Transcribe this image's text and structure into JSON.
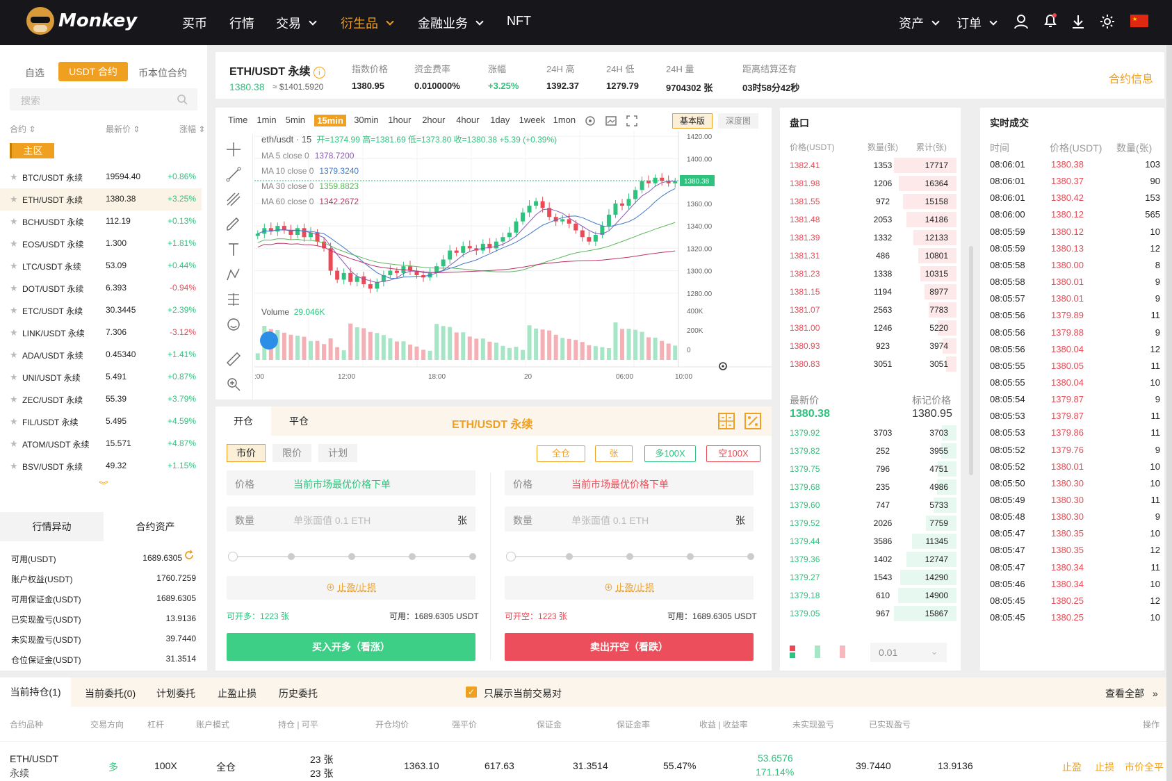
{
  "brand": {
    "name": "Monkey"
  },
  "nav": [
    {
      "label": "买币",
      "dropdown": false
    },
    {
      "label": "行情",
      "dropdown": false
    },
    {
      "label": "交易",
      "dropdown": true
    },
    {
      "label": "衍生品",
      "dropdown": true,
      "active": true
    },
    {
      "label": "金融业务",
      "dropdown": true
    },
    {
      "label": "NFT",
      "dropdown": false
    }
  ],
  "nav_right": [
    {
      "label": "资产"
    },
    {
      "label": "订单"
    }
  ],
  "colors": {
    "accent": "#f0a020",
    "up": "#2ec27e",
    "down": "#ea4a55",
    "header": "#17171b"
  },
  "market_tabs": [
    "自选",
    "USDT 合约",
    "币本位合约"
  ],
  "search_placeholder": "搜索",
  "market_cols": [
    "合约",
    "最新价",
    "涨幅"
  ],
  "zone": "主区",
  "markets": [
    {
      "name": "BTC/USDT 永续",
      "price": "19594.40",
      "change": "+0.86%",
      "dir": "up"
    },
    {
      "name": "ETH/USDT 永续",
      "price": "1380.38",
      "change": "+3.25%",
      "dir": "up"
    },
    {
      "name": "BCH/USDT 永续",
      "price": "112.19",
      "change": "+0.13%",
      "dir": "up"
    },
    {
      "name": "EOS/USDT 永续",
      "price": "1.300",
      "change": "+1.81%",
      "dir": "up"
    },
    {
      "name": "LTC/USDT 永续",
      "price": "53.09",
      "change": "+0.44%",
      "dir": "up"
    },
    {
      "name": "DOT/USDT 永续",
      "price": "6.393",
      "change": "-0.94%",
      "dir": "down"
    },
    {
      "name": "ETC/USDT 永续",
      "price": "30.3445",
      "change": "+2.39%",
      "dir": "up"
    },
    {
      "name": "LINK/USDT 永续",
      "price": "7.306",
      "change": "-3.12%",
      "dir": "down"
    },
    {
      "name": "ADA/USDT 永续",
      "price": "0.45340",
      "change": "+1.41%",
      "dir": "up"
    },
    {
      "name": "UNI/USDT 永续",
      "price": "5.491",
      "change": "+0.87%",
      "dir": "up"
    },
    {
      "name": "ZEC/USDT 永续",
      "price": "55.39",
      "change": "+3.79%",
      "dir": "up"
    },
    {
      "name": "FIL/USDT 永续",
      "price": "5.495",
      "change": "+4.59%",
      "dir": "up"
    },
    {
      "name": "ATOM/USDT 永续",
      "price": "15.571",
      "change": "+4.87%",
      "dir": "up"
    },
    {
      "name": "BSV/USDT 永续",
      "price": "49.32",
      "change": "+1.15%",
      "dir": "up"
    }
  ],
  "asset_tabs": [
    "行情异动",
    "合约资产"
  ],
  "assets": [
    {
      "label": "可用(USDT)",
      "value": "1689.6305"
    },
    {
      "label": "账户权益(USDT)",
      "value": "1760.7259"
    },
    {
      "label": "可用保证金(USDT)",
      "value": "1689.6305"
    },
    {
      "label": "已实现盈亏(USDT)",
      "value": "13.9136"
    },
    {
      "label": "未实现盈亏(USDT)",
      "value": "39.7440"
    },
    {
      "label": "仓位保证金(USDT)",
      "value": "31.3514"
    }
  ],
  "ticker": {
    "symbol": "ETH/USDT 永续",
    "last": "1380.38",
    "last_usd": "≈ $1401.5920",
    "stats": [
      {
        "label": "指数价格",
        "value": "1380.95"
      },
      {
        "label": "资金费率",
        "value": "0.010000%"
      },
      {
        "label": "涨幅",
        "value": "+3.25%"
      },
      {
        "label": "24H 高",
        "value": "1392.37"
      },
      {
        "label": "24H 低",
        "value": "1279.79"
      },
      {
        "label": "24H 量",
        "value": "9704302 张"
      },
      {
        "label": "距离结算还有",
        "value": "03时58分42秒"
      }
    ],
    "info_link": "合约信息"
  },
  "chart_toolbar": {
    "intervals": [
      "Time",
      "1min",
      "5min",
      "15min",
      "30min",
      "1hour",
      "2hour",
      "4hour",
      "1day",
      "1week",
      "1mon"
    ],
    "active": "15min",
    "modes": [
      "基本版",
      "深度图"
    ]
  },
  "chart_legend": {
    "head": "eth/usdt · 15",
    "ohlc": "开=1374.99 高=1381.69 低=1373.80 收=1380.38 +5.39 (+0.39%)",
    "ma": [
      {
        "label": "MA 5 close 0",
        "value": "1378.7200",
        "color": "#8c5ab8"
      },
      {
        "label": "MA 10 close 0",
        "value": "1379.3240",
        "color": "#3f78c8"
      },
      {
        "label": "MA 30 close 0",
        "value": "1359.8823",
        "color": "#5cb85c"
      },
      {
        "label": "MA 60 close 0",
        "value": "1342.2672",
        "color": "#c0306a"
      }
    ],
    "volume_label": "Volume",
    "volume_value": "29.046K",
    "price_tag": "1380.38"
  },
  "chart_data": {
    "type": "candlestick",
    "y_ticks": [
      "1420.00",
      "1400.00",
      "1380.00",
      "1360.00",
      "1340.00",
      "1320.00",
      "1300.00",
      "1280.00"
    ],
    "ylim": [
      1270,
      1425
    ],
    "vol_ticks": [
      "400K",
      "200K",
      "0"
    ],
    "x_ticks": [
      ":00",
      "12:00",
      "18:00",
      "20",
      "06:00",
      "10:00"
    ],
    "close": [
      1333,
      1338,
      1335,
      1340,
      1336,
      1332,
      1338,
      1330,
      1334,
      1326,
      1320,
      1300,
      1292,
      1298,
      1290,
      1295,
      1288,
      1284,
      1290,
      1296,
      1300,
      1298,
      1304,
      1300,
      1296,
      1294,
      1298,
      1304,
      1310,
      1318,
      1316,
      1322,
      1320,
      1318,
      1324,
      1320,
      1326,
      1330,
      1334,
      1344,
      1352,
      1358,
      1362,
      1356,
      1348,
      1344,
      1346,
      1342,
      1336,
      1330,
      1326,
      1332,
      1340,
      1350,
      1360,
      1358,
      1364,
      1372,
      1380,
      1378,
      1383,
      1380,
      1378,
      1380
    ]
  },
  "orderbook": {
    "title": "盘口",
    "cols": [
      "价格(USDT)",
      "数量(张)",
      "累计(张)"
    ],
    "asks": [
      [
        "1382.41",
        "1353",
        "17717"
      ],
      [
        "1381.98",
        "1206",
        "16364"
      ],
      [
        "1381.55",
        "972",
        "15158"
      ],
      [
        "1381.48",
        "2053",
        "14186"
      ],
      [
        "1381.39",
        "1332",
        "12133"
      ],
      [
        "1381.31",
        "486",
        "10801"
      ],
      [
        "1381.23",
        "1338",
        "10315"
      ],
      [
        "1381.15",
        "1194",
        "8977"
      ],
      [
        "1381.07",
        "2563",
        "7783"
      ],
      [
        "1381.00",
        "1246",
        "5220"
      ],
      [
        "1380.93",
        "923",
        "3974"
      ],
      [
        "1380.83",
        "3051",
        "3051"
      ]
    ],
    "last_label": "最新价",
    "mark_label": "标记价格",
    "last": "1380.38",
    "mark": "1380.95",
    "bids": [
      [
        "1379.92",
        "3703",
        "3703"
      ],
      [
        "1379.82",
        "252",
        "3955"
      ],
      [
        "1379.75",
        "796",
        "4751"
      ],
      [
        "1379.68",
        "235",
        "4986"
      ],
      [
        "1379.60",
        "747",
        "5733"
      ],
      [
        "1379.52",
        "2026",
        "7759"
      ],
      [
        "1379.44",
        "3586",
        "11345"
      ],
      [
        "1379.36",
        "1402",
        "12747"
      ],
      [
        "1379.27",
        "1543",
        "14290"
      ],
      [
        "1379.18",
        "610",
        "14900"
      ],
      [
        "1379.05",
        "967",
        "15867"
      ]
    ],
    "precision": "0.01"
  },
  "trades": {
    "title": "实时成交",
    "cols": [
      "时间",
      "价格(USDT)",
      "数量(张)"
    ],
    "rows": [
      [
        "08:06:01",
        "1380.38",
        "103"
      ],
      [
        "08:06:01",
        "1380.37",
        "90"
      ],
      [
        "08:06:01",
        "1380.42",
        "153"
      ],
      [
        "08:06:00",
        "1380.12",
        "565"
      ],
      [
        "08:05:59",
        "1380.12",
        "10"
      ],
      [
        "08:05:59",
        "1380.13",
        "12"
      ],
      [
        "08:05:58",
        "1380.00",
        "8"
      ],
      [
        "08:05:58",
        "1380.01",
        "9"
      ],
      [
        "08:05:57",
        "1380.01",
        "9"
      ],
      [
        "08:05:56",
        "1379.89",
        "11"
      ],
      [
        "08:05:56",
        "1379.88",
        "9"
      ],
      [
        "08:05:56",
        "1380.04",
        "12"
      ],
      [
        "08:05:55",
        "1380.05",
        "11"
      ],
      [
        "08:05:55",
        "1380.04",
        "10"
      ],
      [
        "08:05:54",
        "1379.87",
        "9"
      ],
      [
        "08:05:53",
        "1379.87",
        "11"
      ],
      [
        "08:05:53",
        "1379.86",
        "11"
      ],
      [
        "08:05:52",
        "1379.76",
        "9"
      ],
      [
        "08:05:52",
        "1380.01",
        "10"
      ],
      [
        "08:05:50",
        "1380.30",
        "10"
      ],
      [
        "08:05:49",
        "1380.30",
        "11"
      ],
      [
        "08:05:48",
        "1380.30",
        "9"
      ],
      [
        "08:05:47",
        "1380.35",
        "10"
      ],
      [
        "08:05:47",
        "1380.35",
        "12"
      ],
      [
        "08:05:47",
        "1380.34",
        "11"
      ],
      [
        "08:05:46",
        "1380.34",
        "10"
      ],
      [
        "08:05:45",
        "1380.25",
        "12"
      ],
      [
        "08:05:45",
        "1380.25",
        "10"
      ]
    ]
  },
  "trade_form": {
    "tabs": [
      "开仓",
      "平仓"
    ],
    "title": "ETH/USDT 永续",
    "order_types": [
      "市价",
      "限价",
      "计划"
    ],
    "options": [
      "全仓",
      "张",
      "多100X",
      "空100X"
    ],
    "price_label": "价格",
    "price_hint": "当前市场最优价格下单",
    "qty_label": "数量",
    "qty_placeholder": "单张面值 0.1 ETH",
    "qty_unit": "张",
    "tpsl": "止盈/止损",
    "long_avail_label": "可开多：",
    "long_avail": "1223 张",
    "short_avail_label": "可开空：",
    "short_avail": "1223 张",
    "usable_label": "可用：",
    "usable": "1689.6305 USDT",
    "buy": "买入开多（看涨）",
    "sell": "卖出开空（看跌）"
  },
  "positions": {
    "tabs": [
      "当前持仓(1)",
      "当前委托(0)",
      "计划委托",
      "止盈止损",
      "历史委托"
    ],
    "filter": "只展示当前交易对",
    "view_all": "查看全部",
    "cols": [
      "合约品种",
      "交易方向",
      "杠杆",
      "账户模式",
      "持仓 | 可平",
      "开仓均价",
      "强平价",
      "保证金",
      "保证金率",
      "收益 | 收益率",
      "未实现盈亏",
      "已实现盈亏",
      "操作"
    ],
    "row": {
      "symbol": "ETH/USDT",
      "sub": "永续",
      "side": "多",
      "lev": "100X",
      "mode": "全仓",
      "hold": "23 张",
      "avail": "23 张",
      "open": "1363.10",
      "liq": "617.63",
      "margin": "31.3514",
      "ratio": "55.47%",
      "pnl": "53.6576",
      "pnl_rate": "171.14%",
      "unreal": "39.7440",
      "real": "13.9136"
    },
    "actions": [
      "止盈",
      "止损",
      "市价全平"
    ]
  }
}
